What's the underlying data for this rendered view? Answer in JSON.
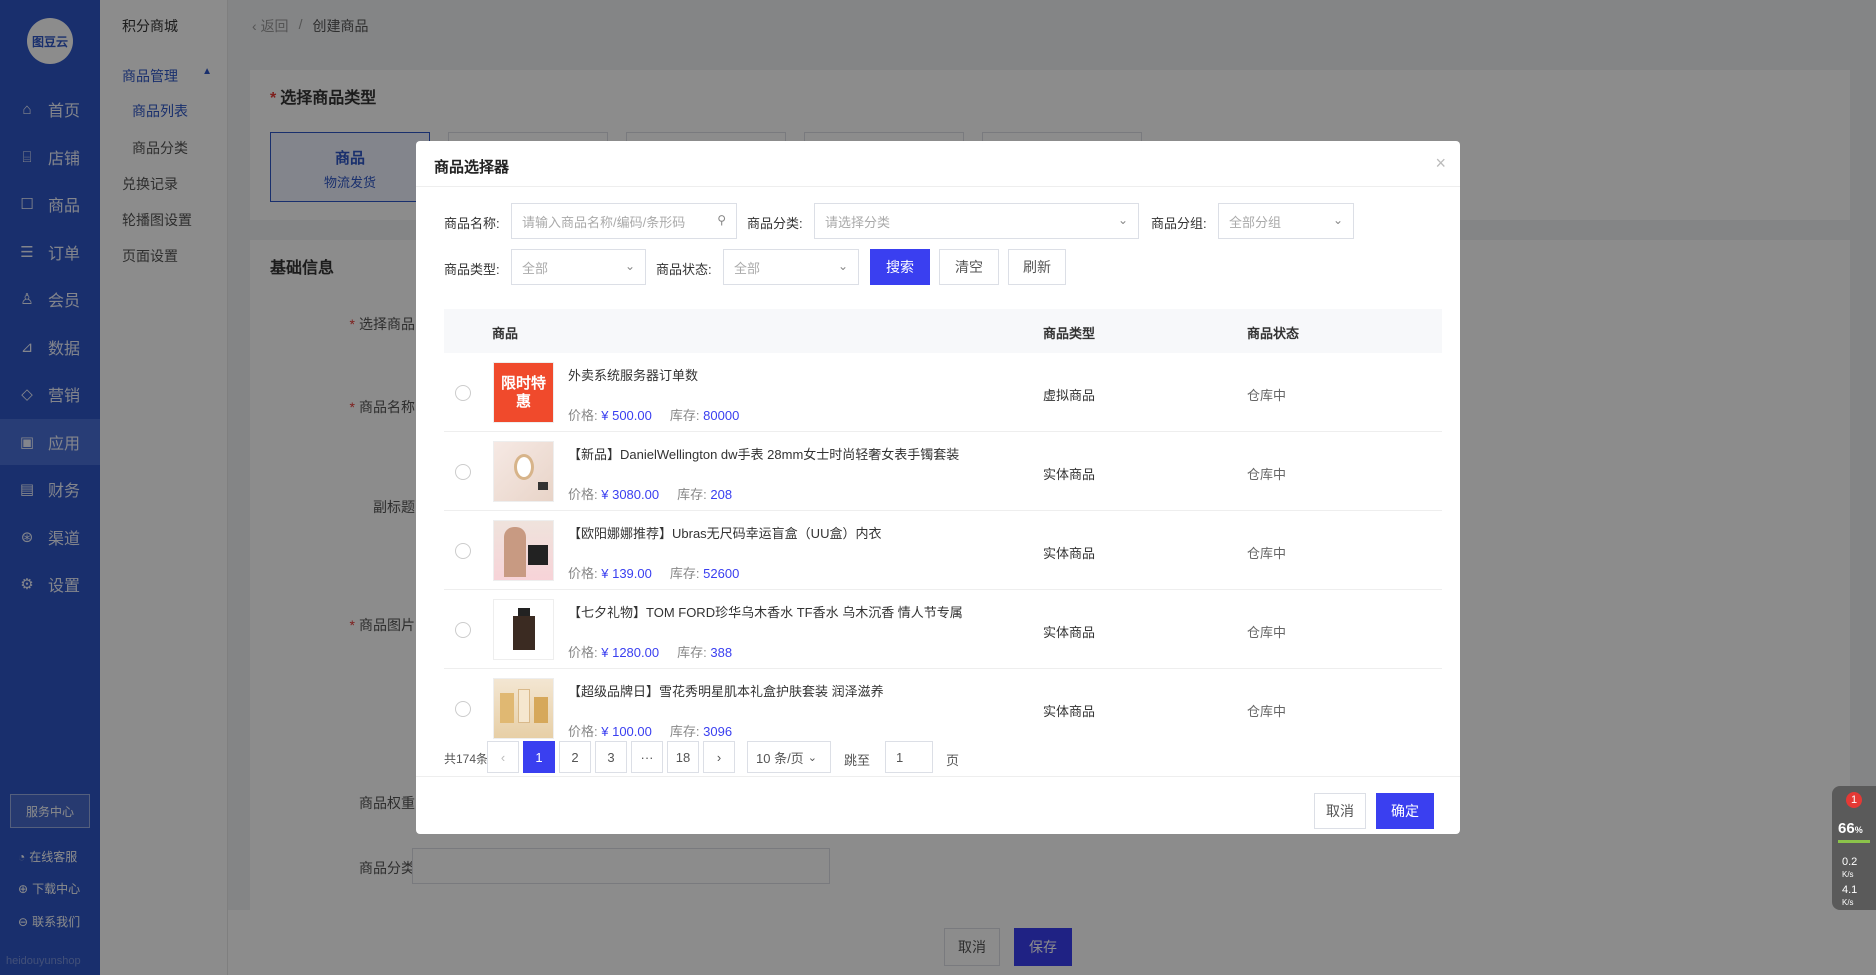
{
  "nav": {
    "logo": "图豆云",
    "items": [
      {
        "label": "首页",
        "icon": "home-icon",
        "glyph": "⌂"
      },
      {
        "label": "店铺",
        "icon": "store-icon",
        "glyph": "⌸"
      },
      {
        "label": "商品",
        "icon": "goods-icon",
        "glyph": "☐"
      },
      {
        "label": "订单",
        "icon": "order-icon",
        "glyph": "☰"
      },
      {
        "label": "会员",
        "icon": "member-icon",
        "glyph": "♙"
      },
      {
        "label": "数据",
        "icon": "data-icon",
        "glyph": "⊿"
      },
      {
        "label": "营销",
        "icon": "marketing-icon",
        "glyph": "◇"
      },
      {
        "label": "应用",
        "icon": "app-icon",
        "glyph": "▣"
      },
      {
        "label": "财务",
        "icon": "finance-icon",
        "glyph": "▤"
      },
      {
        "label": "渠道",
        "icon": "channel-icon",
        "glyph": "⊛"
      },
      {
        "label": "设置",
        "icon": "settings-icon",
        "glyph": "⚙"
      }
    ],
    "service_center": "服务中心",
    "footer": [
      "在线客服",
      "下载中心",
      "联系我们"
    ],
    "watermark": "heidouyunshop"
  },
  "subnav": {
    "title": "积分商城",
    "group": "商品管理",
    "items": [
      "商品列表",
      "商品分类"
    ],
    "links": [
      "兑换记录",
      "轮播图设置",
      "页面设置"
    ]
  },
  "breadcrumb": {
    "back": "返回",
    "separator": "/",
    "current": "创建商品"
  },
  "page": {
    "section1_title": "选择商品类型",
    "type_card": {
      "title": "商品",
      "subtitle": "物流发货"
    },
    "section2_title": "基础信息",
    "fields": [
      "选择商品",
      "商品名称",
      "副标题",
      "商品图片",
      "商品权重",
      "商品分类"
    ],
    "cancel": "取消",
    "save": "保存"
  },
  "modal": {
    "title": "商品选择器",
    "filters": {
      "name_label": "商品名称:",
      "name_placeholder": "请输入商品名称/编码/条形码",
      "category_label": "商品分类:",
      "category_placeholder": "请选择分类",
      "group_label": "商品分组:",
      "group_value": "全部分组",
      "type_label": "商品类型:",
      "type_value": "全部",
      "status_label": "商品状态:",
      "status_value": "全部"
    },
    "buttons": {
      "search": "搜索",
      "clear": "清空",
      "refresh": "刷新"
    },
    "table": {
      "headers": [
        "商品",
        "商品类型",
        "商品状态"
      ],
      "price_label": "价格:",
      "stock_label": "库存:",
      "rows": [
        {
          "name": "外卖系统服务器订单数",
          "price": "¥ 500.00",
          "stock": "80000",
          "type": "虚拟商品",
          "status": "仓库中",
          "thumb_text": "限时特惠"
        },
        {
          "name": "【新品】DanielWellington dw手表 28mm女士时尚轻奢女表手镯套装",
          "price": "¥ 3080.00",
          "stock": "208",
          "type": "实体商品",
          "status": "仓库中",
          "thumb_text": ""
        },
        {
          "name": "【欧阳娜娜推荐】Ubras无尺码幸运盲盒（UU盒）内衣",
          "price": "¥ 139.00",
          "stock": "52600",
          "type": "实体商品",
          "status": "仓库中",
          "thumb_text": ""
        },
        {
          "name": "【七夕礼物】TOM FORD珍华乌木香水 TF香水 乌木沉香 情人节专属",
          "price": "¥ 1280.00",
          "stock": "388",
          "type": "实体商品",
          "status": "仓库中",
          "thumb_text": ""
        },
        {
          "name": "【超级品牌日】雪花秀明星肌本礼盒护肤套装 润泽滋养",
          "price": "¥ 100.00",
          "stock": "3096",
          "type": "实体商品",
          "status": "仓库中",
          "thumb_text": ""
        }
      ]
    },
    "pagination": {
      "total": "共174条",
      "prev": "‹",
      "pages": [
        "1",
        "2",
        "3",
        "···",
        "18"
      ],
      "current": "1",
      "next": "›",
      "page_size": "10 条/页",
      "jump_label": "跳至",
      "jump_value": "1",
      "page_suffix": "页"
    },
    "cancel": "取消",
    "confirm": "确定"
  },
  "widget": {
    "badge": "1",
    "percent": "66",
    "percent_unit": "%",
    "up": "0.2",
    "down": "4.1",
    "unit": "K/s"
  },
  "colors": {
    "primary": "#3a3ff0",
    "nav_bg": "#2f57c7"
  }
}
